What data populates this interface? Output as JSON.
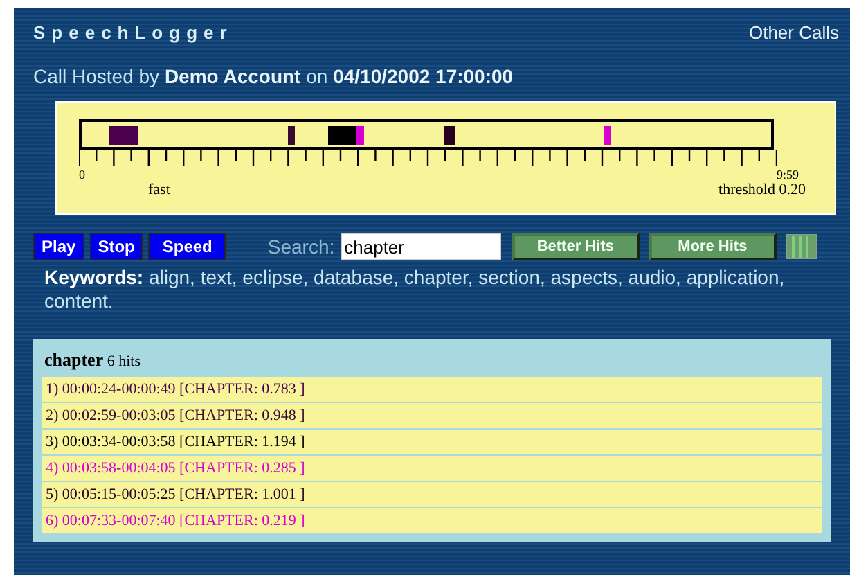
{
  "header": {
    "title": "SpeechLogger",
    "link": "Other Calls"
  },
  "call_info": {
    "prefix": "Call Hosted by",
    "host": "Demo Account",
    "middle": "on",
    "date": "04/10/2002 17:00:00"
  },
  "timeline": {
    "start_label": "0",
    "end_label": "9:59",
    "speed_label": "fast",
    "threshold_label": "threshold 0.20"
  },
  "controls": {
    "buttons": [
      "Play",
      "Stop",
      "Speed"
    ],
    "search_label": "Search:",
    "search_value": "chapter",
    "hit_buttons": [
      "Better Hits",
      "More Hits"
    ]
  },
  "keywords": {
    "label": "Keywords:",
    "text": "align, text, eclipse, database, chapter, section, aspects, audio, application, content."
  },
  "results": {
    "term": "chapter",
    "count": "6 hits",
    "hits": [
      {
        "text": "1) 00:00:24-00:00:49 [CHAPTER: 0.783 ]",
        "color": "#4b0050"
      },
      {
        "text": "2) 00:02:59-00:03:05 [CHAPTER: 0.948 ]",
        "color": "#3a0a30"
      },
      {
        "text": "3) 00:03:34-00:03:58 [CHAPTER: 1.194 ]",
        "color": "#000000"
      },
      {
        "text": "4) 00:03:58-00:04:05 [CHAPTER: 0.285 ]",
        "color": "#d400d4"
      },
      {
        "text": "5) 00:05:15-00:05:25 [CHAPTER: 1.001 ]",
        "color": "#2a0020"
      },
      {
        "text": "6) 00:07:33-00:07:40 [CHAPTER: 0.219 ]",
        "color": "#d400d4"
      }
    ]
  }
}
